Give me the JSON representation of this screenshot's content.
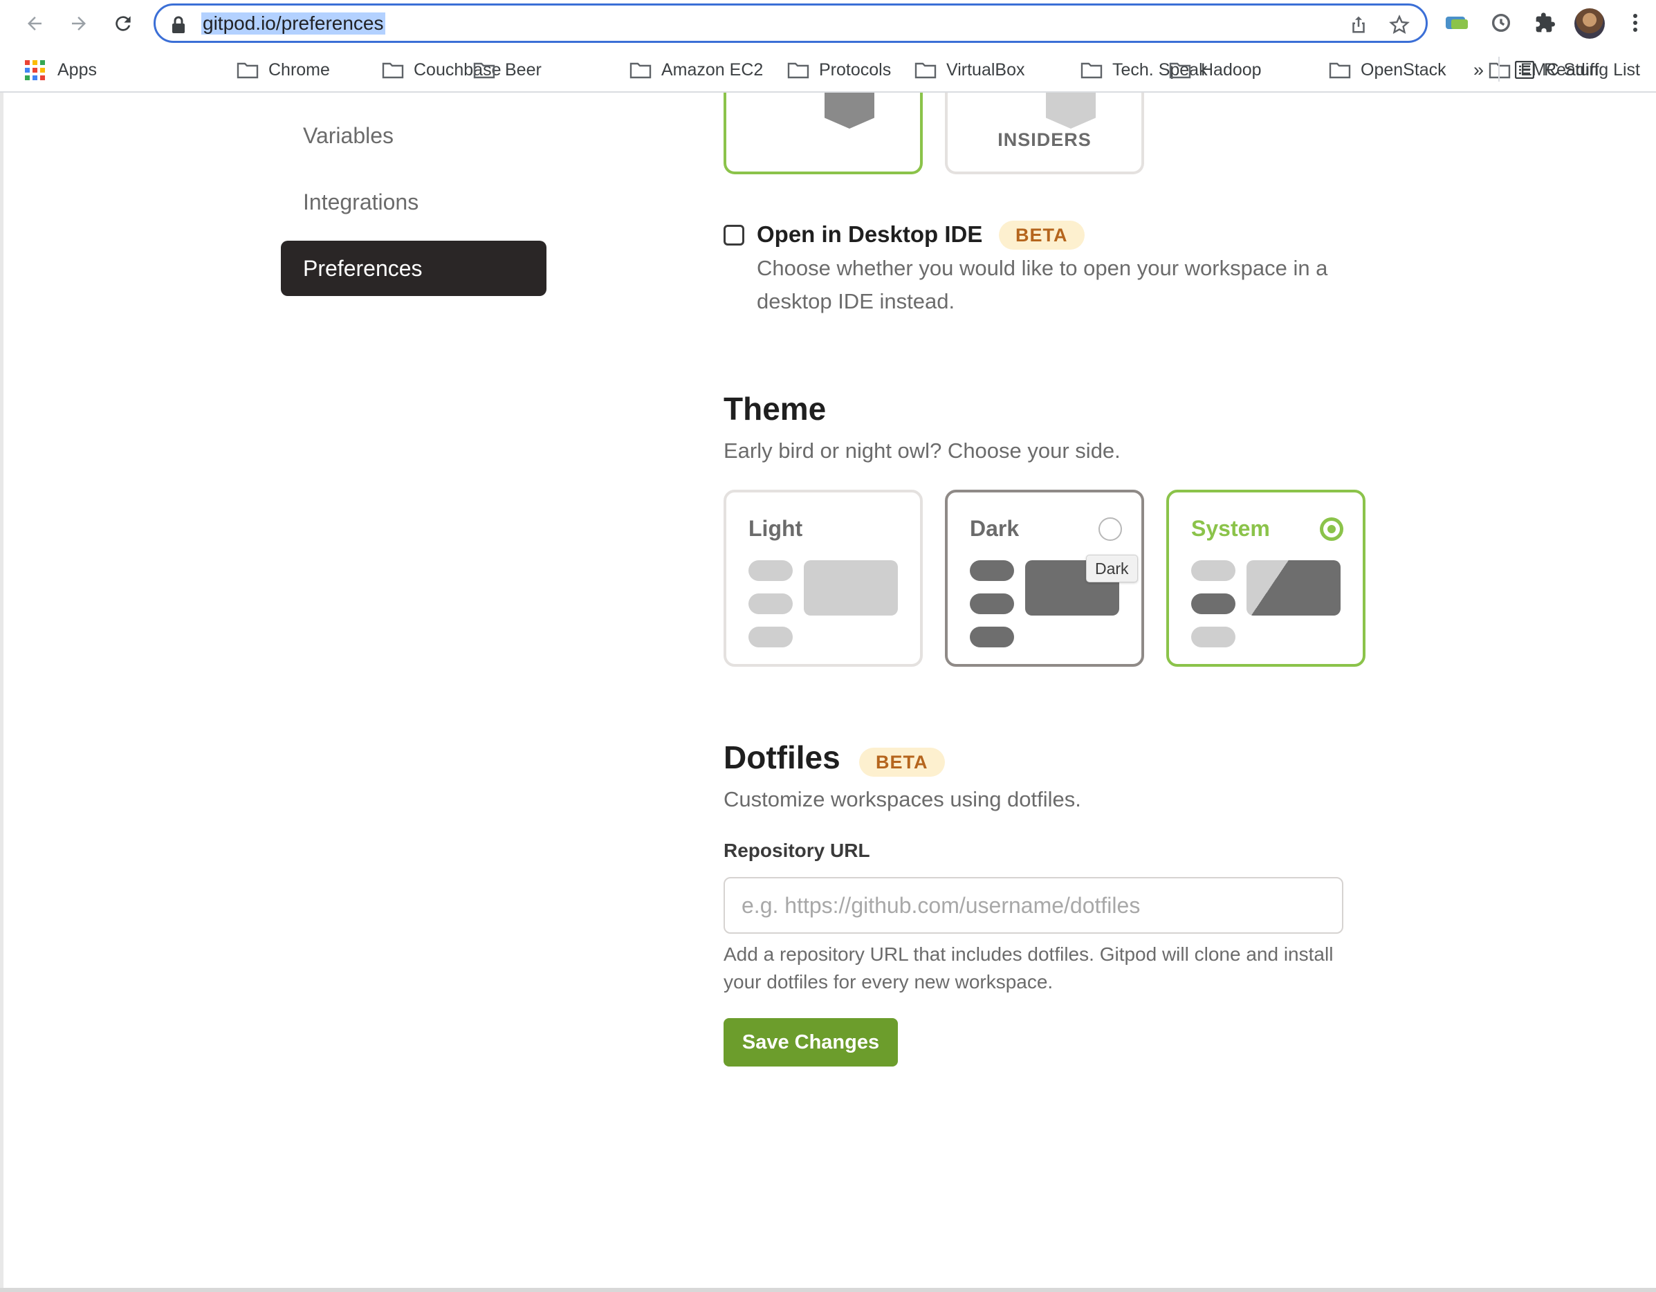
{
  "browser": {
    "url": "gitpod.io/preferences",
    "bookmarks": [
      "Apps",
      "Chrome",
      "Couchbase",
      "Beer",
      "Amazon EC2",
      "Protocols",
      "VirtualBox",
      "Tech. Speak",
      "Hadoop",
      "OpenStack",
      "EMC Stuff"
    ],
    "overflow": "»",
    "reading_list": "Reading List"
  },
  "sidebar": {
    "items": [
      {
        "label": "Variables",
        "active": false
      },
      {
        "label": "Integrations",
        "active": false
      },
      {
        "label": "Preferences",
        "active": true
      }
    ]
  },
  "ide": {
    "selected_card_label": "",
    "other_card_label": "INSIDERS",
    "desktop_checkbox_label": "Open in Desktop IDE",
    "desktop_checked": false,
    "desktop_beta": "BETA",
    "desktop_description": "Choose whether you would like to open your workspace in a desktop IDE instead."
  },
  "theme": {
    "title": "Theme",
    "subtitle": "Early bird or night owl? Choose your side.",
    "options": [
      {
        "label": "Light",
        "selected": false
      },
      {
        "label": "Dark",
        "selected": false
      },
      {
        "label": "System",
        "selected": true
      }
    ],
    "tooltip": "Dark"
  },
  "dotfiles": {
    "title": "Dotfiles",
    "beta": "BETA",
    "subtitle": "Customize workspaces using dotfiles.",
    "repo_label": "Repository URL",
    "repo_placeholder": "e.g. https://github.com/username/dotfiles",
    "repo_value": "",
    "help": "Add a repository URL that includes dotfiles. Gitpod will clone and install your dotfiles for every new workspace.",
    "save_label": "Save Changes"
  },
  "colors": {
    "accent_green": "#8bc34a",
    "save_green": "#6c9d2c",
    "beta_bg": "#fdf0cf",
    "beta_text": "#b5651d",
    "active_nav": "#2a2626"
  }
}
